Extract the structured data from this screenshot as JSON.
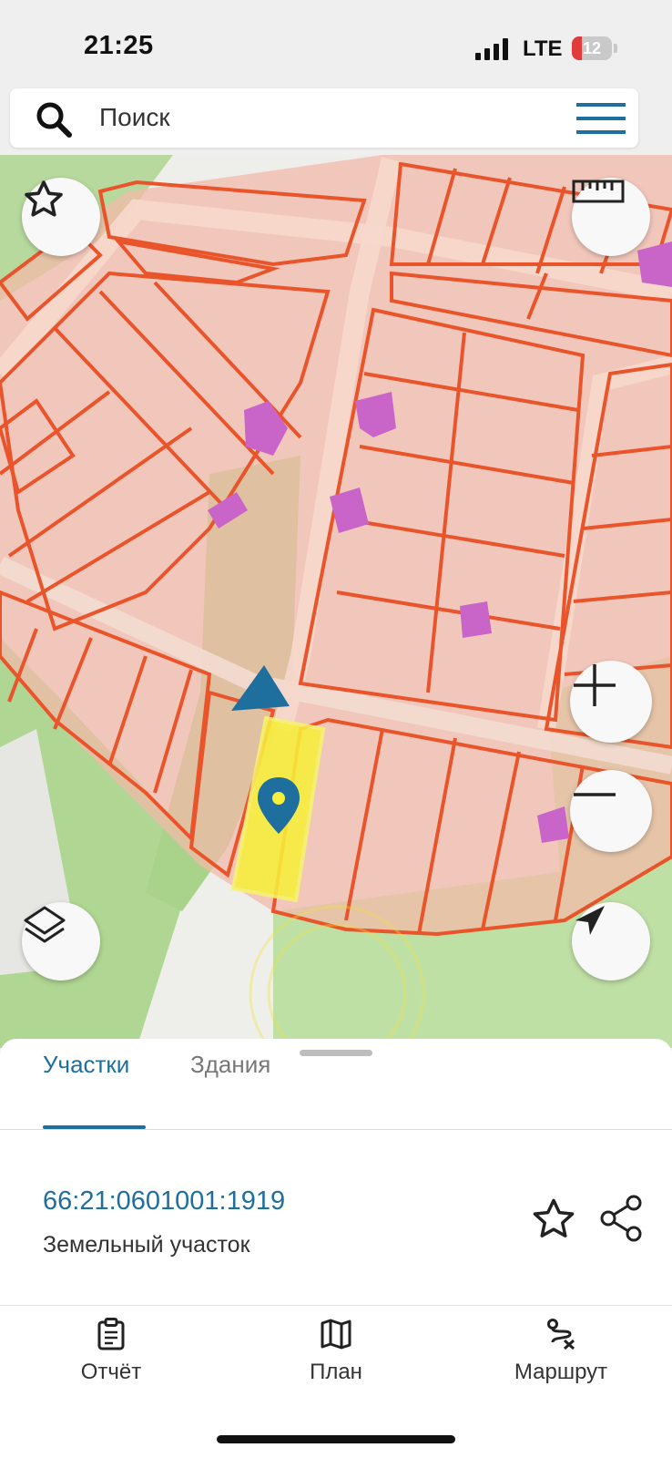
{
  "status_bar": {
    "time": "21:25",
    "network": "LTE",
    "battery": "12"
  },
  "search": {
    "placeholder": "Поиск"
  },
  "map": {
    "buttons": [
      "star-icon",
      "ruler-icon",
      "zoom-in-icon",
      "zoom-out-icon",
      "layers-icon",
      "navigation-arrow-icon"
    ],
    "colors": {
      "parcel_border": "#e9542b",
      "parcel_fill": "#f7c9bd",
      "green": "#a9d38a",
      "selected": "#f7ef3b",
      "building": "#c964c8",
      "accent": "#1f6f9e"
    }
  },
  "sheet": {
    "tabs": [
      "Участки",
      "Здания"
    ],
    "active_tab": "Участки",
    "parcel": {
      "id": "66:21:0601001:1919",
      "type": "Земельный участок"
    }
  },
  "bottom_nav": {
    "report": "Отчёт",
    "plan": "План",
    "route": "Маршрут"
  }
}
